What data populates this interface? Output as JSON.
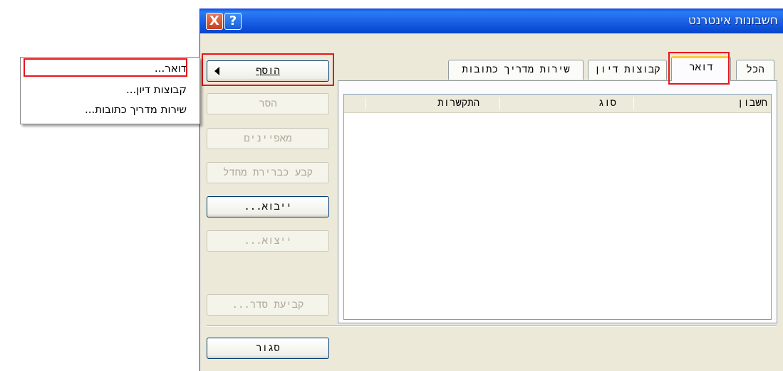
{
  "window": {
    "title": "חשבונות אינטרנט",
    "close_glyph": "X",
    "help_glyph": "?"
  },
  "tabs": [
    {
      "label": "הכל",
      "active": false
    },
    {
      "label": "דואר",
      "active": true
    },
    {
      "label": "קבוצות דיון",
      "active": false
    },
    {
      "label": "שירות מדריך כתובות",
      "active": false
    }
  ],
  "list": {
    "columns": [
      "חשבון",
      "סוג",
      "התקשרות"
    ],
    "rows": []
  },
  "buttons": {
    "add": "הוסף",
    "remove": "הסר",
    "properties": "מאפיינים",
    "set_default": "קבע כברירת מחדל",
    "import": "ייבוא...",
    "export": "ייצוא...",
    "set_order": "קביעת סדר...",
    "close": "סגור"
  },
  "add_menu": {
    "items": [
      "דואר...",
      "קבוצות דיון...",
      "שירות מדריך כתובות..."
    ]
  },
  "colors": {
    "highlight": "#e8151c",
    "titlebar": "#0b4fd8",
    "dialog_bg": "#ece9d8"
  }
}
